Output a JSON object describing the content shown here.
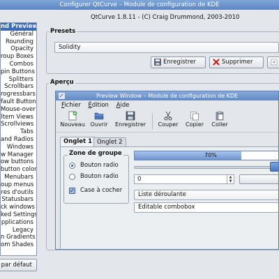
{
  "window": {
    "title": "Configurer QtCurve – Module de configuration de KDE",
    "version": "QtCurve 1.8.11 - (C) Craig Drummond, 2003-2010"
  },
  "sidebar": {
    "items": [
      "nd Preview",
      "Général",
      "Rounding",
      "Opacity",
      "roup Boxes",
      "Combos",
      "pin Buttons",
      "Splitters",
      "Scrollbars",
      "rogressbars",
      "fault Button",
      "Mouse-over",
      "ltem Views",
      "Scrollviews",
      "Tabs",
      "and Radios",
      "Windows",
      "w Manager",
      "ow buttons",
      "button colors",
      "Menubars",
      "oup menus",
      "res d'outils",
      "Statusbars",
      "ck windows",
      "ked Settings",
      "pplications",
      "Legacy",
      "n Gradients",
      "om Shades"
    ],
    "selected_index": 0,
    "defaults_button": "par défaut"
  },
  "presets": {
    "label": "Presets",
    "value": "Solidity",
    "save": "Enregistrer",
    "delete": "Supprimer"
  },
  "apercu": {
    "label": "Aperçu"
  },
  "preview_window": {
    "title": "Preview Window – Module de configuration de KDE",
    "menus": [
      "Fichier",
      "Édition",
      "Aide"
    ],
    "toolbar": [
      "Nouveau",
      "Ouvrir",
      "Enregistrer",
      "Couper",
      "Copier",
      "Coller"
    ],
    "tabs": [
      "Onglet 1",
      "Onglet 2"
    ],
    "active_tab": 0,
    "group_label": "Zone de groupe",
    "radio1": "Bouton radio",
    "radio2": "Bouton radio",
    "checkbox": "Case à cocher",
    "progress_value": 0.7,
    "progress_label": "70%",
    "spin_value": "0",
    "dropdown": "Liste déroulante",
    "editable_combo": "Editable combobox"
  },
  "colors": {
    "accent": "#3c6bb6",
    "titlebar": "#6a90ca",
    "delete_icon": "#d02020"
  }
}
